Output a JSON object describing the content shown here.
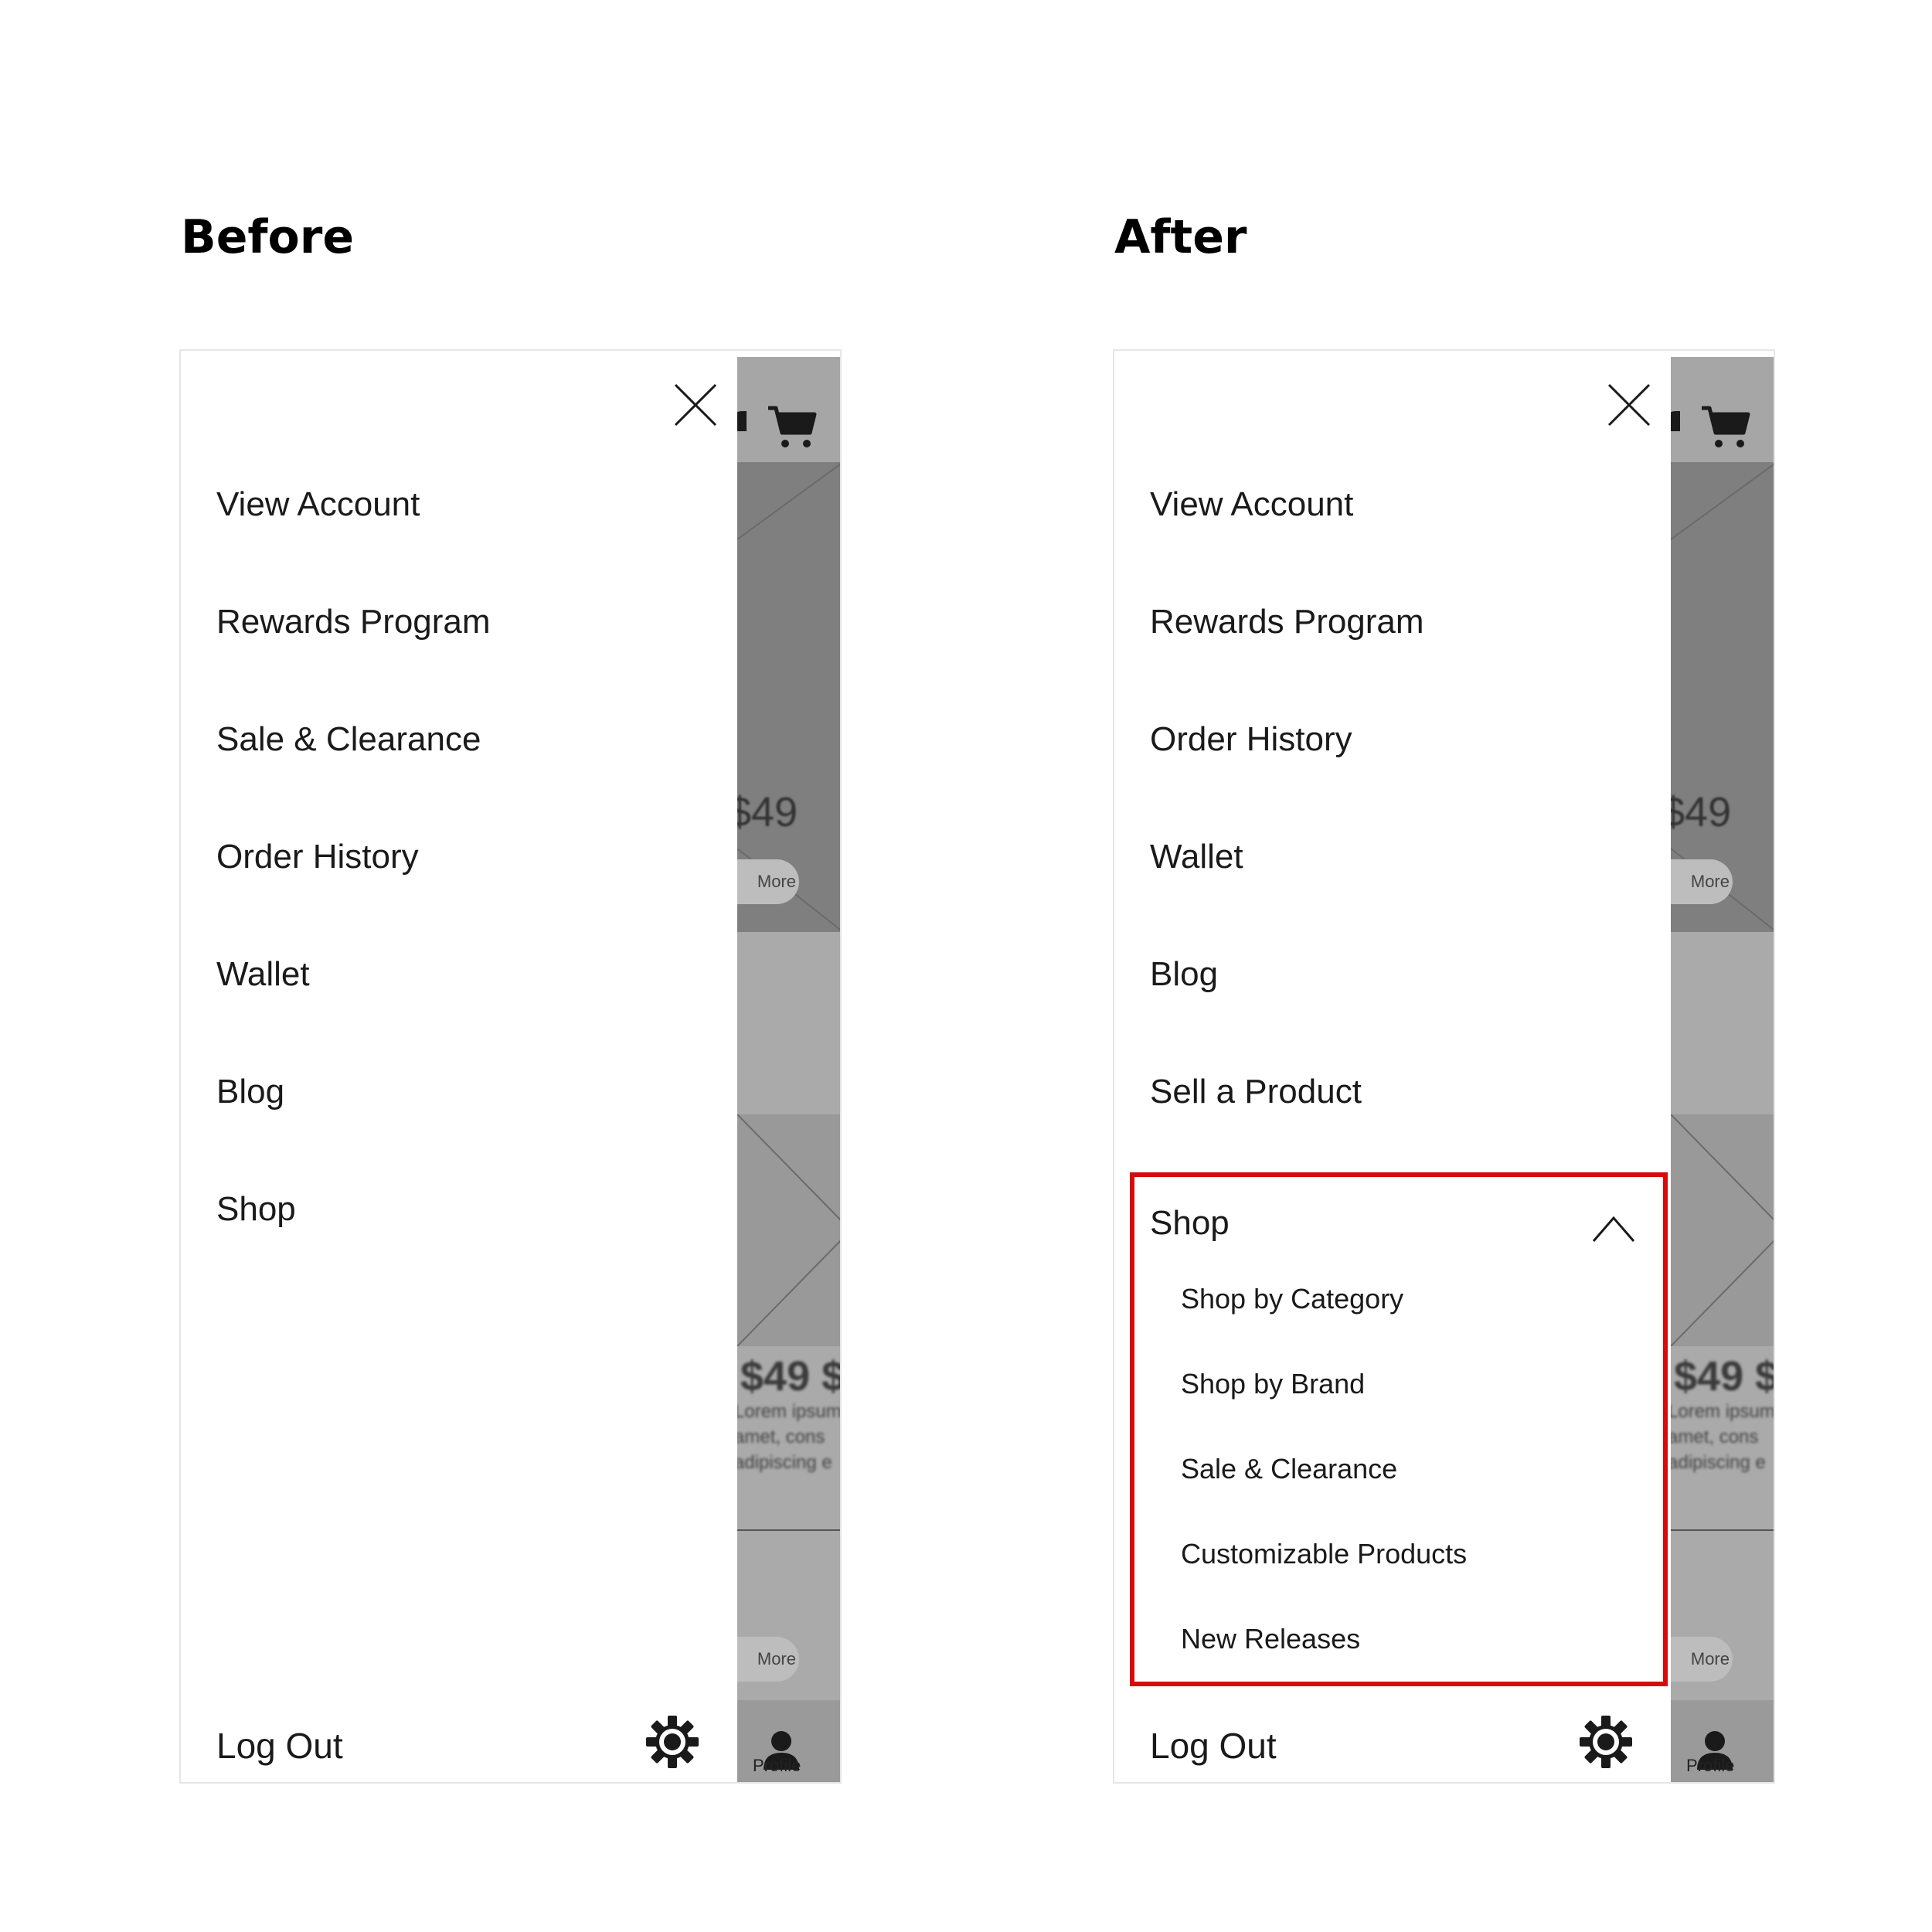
{
  "before": {
    "heading": "Before",
    "menu": [
      "View Account",
      "Rewards Program",
      "Sale & Clearance",
      "Order History",
      "Wallet",
      "Blog",
      "Shop"
    ],
    "logout": "Log Out"
  },
  "after": {
    "heading": "After",
    "menu": [
      "View Account",
      "Rewards Program",
      "Order History",
      "Wallet",
      "Blog",
      "Sell a Product"
    ],
    "shop": {
      "label": "Shop",
      "expanded": true,
      "items": [
        "Shop by Category",
        "Shop by Brand",
        "Sale & Clearance",
        "Customizable Products",
        "New Releases"
      ]
    },
    "logout": "Log Out"
  },
  "background": {
    "price": "$49",
    "price_strike": "$49 $",
    "lorem": [
      "Lorem ipsum",
      "amet, cons",
      "adipiscing e"
    ],
    "more": "More",
    "profile": "Profile"
  },
  "colors": {
    "highlight": "#d40c0c",
    "overlay": "#aaaaaa"
  },
  "icons": [
    "close-icon",
    "cart-icon",
    "bell-icon",
    "gear-icon",
    "chevron-up-icon",
    "profile-icon"
  ]
}
